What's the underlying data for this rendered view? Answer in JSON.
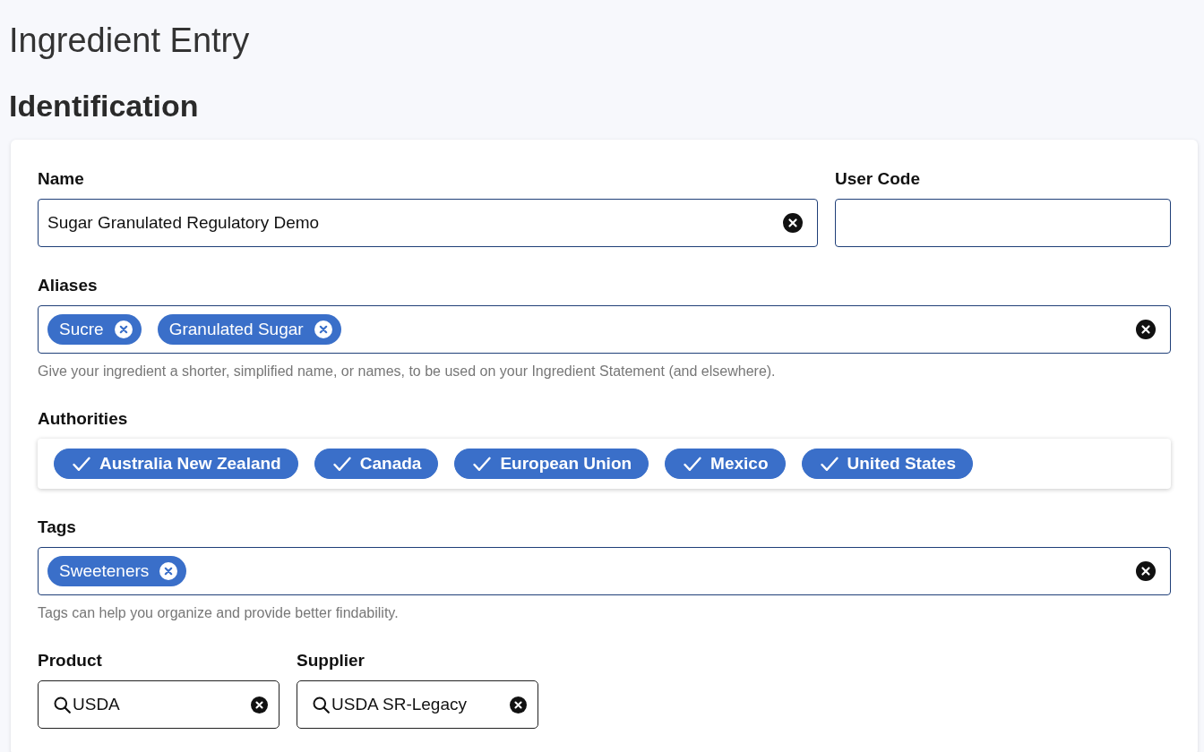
{
  "page_title": "Ingredient Entry",
  "section_title": "Identification",
  "form": {
    "name": {
      "label": "Name",
      "value": "Sugar Granulated Regulatory Demo"
    },
    "user_code": {
      "label": "User Code"
    },
    "aliases": {
      "label": "Aliases",
      "chips": [
        "Sucre",
        "Granulated Sugar"
      ],
      "help": "Give your ingredient a shorter, simplified name, or names, to be used on your Ingredient Statement (and elsewhere)."
    },
    "authorities": {
      "label": "Authorities",
      "items": [
        {
          "label": "Australia New Zealand",
          "checked": true
        },
        {
          "label": "Canada",
          "checked": true
        },
        {
          "label": "European Union",
          "checked": true
        },
        {
          "label": "Mexico",
          "checked": true
        },
        {
          "label": "United States",
          "checked": true
        }
      ]
    },
    "tags": {
      "label": "Tags",
      "chips": [
        "Sweeteners"
      ],
      "help": "Tags can help you organize and provide better findability."
    },
    "product": {
      "label": "Product",
      "value": "USDA"
    },
    "supplier": {
      "label": "Supplier",
      "value": "USDA SR-Legacy"
    }
  }
}
